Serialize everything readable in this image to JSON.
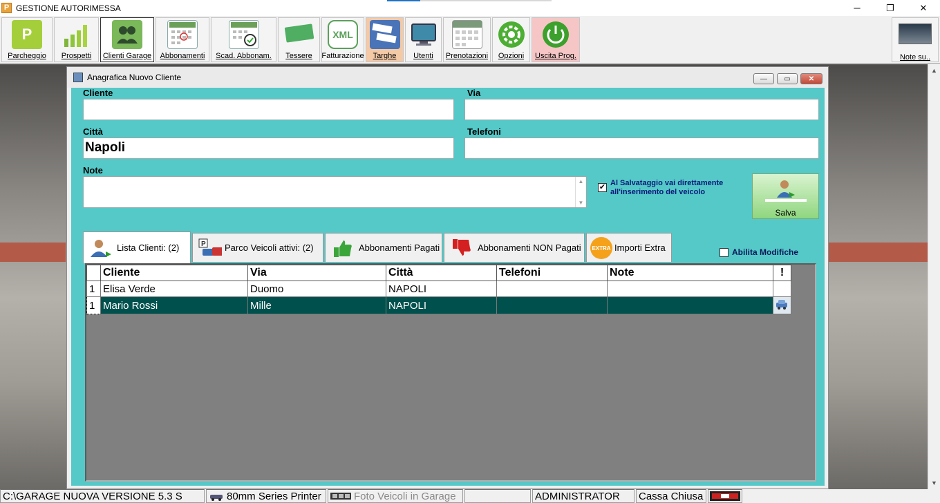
{
  "app": {
    "title": "GESTIONE AUTORIMESSA",
    "logo": "P"
  },
  "window_controls": {
    "minimize": "─",
    "maximize": "❐",
    "close": "✕"
  },
  "toolbar": [
    {
      "label": "Parcheggio",
      "icon": "parking-icon",
      "color": "#a4cf3a"
    },
    {
      "label": "Prospetti",
      "icon": "bar-chart-icon",
      "color": "#8cc43a"
    },
    {
      "label": "Clienti Garage",
      "icon": "users-icon",
      "color": "#7bb85a"
    },
    {
      "label": "Abbonamenti",
      "icon": "calendar-icon",
      "color": "#6c9f58"
    },
    {
      "label": "Scad. Abbonam.",
      "icon": "calendar-check-icon",
      "color": "#6c9f58"
    },
    {
      "label": "Tessere",
      "icon": "card-icon",
      "color": "#4fae62"
    },
    {
      "label": "Fatturazione",
      "icon": "xml-icon",
      "color": "#5aa05a"
    },
    {
      "label": "Targhe",
      "icon": "license-plate-icon",
      "color": "#4a74b8"
    },
    {
      "label": "Utenti",
      "icon": "monitor-icon",
      "color": "#3e8aa8"
    },
    {
      "label": "Prenotazioni",
      "icon": "booking-icon",
      "color": "#7a9a7a"
    },
    {
      "label": "Opzioni",
      "icon": "gear-icon",
      "color": "#4cae32"
    },
    {
      "label": "Uscita Prog.",
      "icon": "power-icon",
      "color": "#3ca02c"
    }
  ],
  "note_su": {
    "label": "Note su.."
  },
  "child_window": {
    "title": "Anagrafica Nuovo Cliente",
    "controls": {
      "minimize": "—",
      "restore": "▭",
      "close": "✕"
    }
  },
  "form": {
    "cliente": {
      "label": "Cliente",
      "value": ""
    },
    "via": {
      "label": "Via",
      "value": ""
    },
    "citta": {
      "label": "Città",
      "value": "Napoli"
    },
    "telefoni": {
      "label": "Telefoni",
      "value": ""
    },
    "note": {
      "label": "Note",
      "value": ""
    },
    "redirect_checkbox": {
      "checked": true,
      "line1": "Al Salvataggio vai direttamente",
      "line2": "all'inserimento del veicolo"
    },
    "save_label": "Salva",
    "abilita_label": "Abilita Modifiche",
    "abilita_checked": false
  },
  "tabs": [
    {
      "label": "Lista Clienti: (2)",
      "icon": "user-add-icon",
      "active": true
    },
    {
      "label": "Parco Veicoli attivi: (2)",
      "icon": "parking-car-icon",
      "active": false
    },
    {
      "label": "Abbonamenti Pagati",
      "icon": "thumbs-up-icon",
      "active": false
    },
    {
      "label": "Abbonamenti NON Pagati",
      "icon": "thumbs-down-icon",
      "active": false
    },
    {
      "label": "Importi Extra",
      "icon": "extra-badge-icon",
      "active": false
    }
  ],
  "extra_badge_text": "EXTRA",
  "grid": {
    "columns": [
      "Cliente",
      "Via",
      "Città",
      "Telefoni",
      "Note",
      "!"
    ],
    "rows": [
      {
        "num": "1",
        "cliente": "Elisa Verde",
        "via": "Duomo",
        "citta": "NAPOLI",
        "telefoni": "",
        "note": "",
        "flag": ""
      },
      {
        "num": "1",
        "cliente": "Mario Rossi",
        "via": "Mille",
        "citta": "NAPOLI",
        "telefoni": "",
        "note": "",
        "flag": "car"
      }
    ]
  },
  "statusbar": {
    "path": "C:\\GARAGE NUOVA VERSIONE 5.3 S",
    "printer": "80mm Series Printer",
    "photo": "Foto Veicoli in Garage",
    "blank": "",
    "user": "ADMINISTRATOR",
    "cassa": "Cassa Chiusa"
  }
}
